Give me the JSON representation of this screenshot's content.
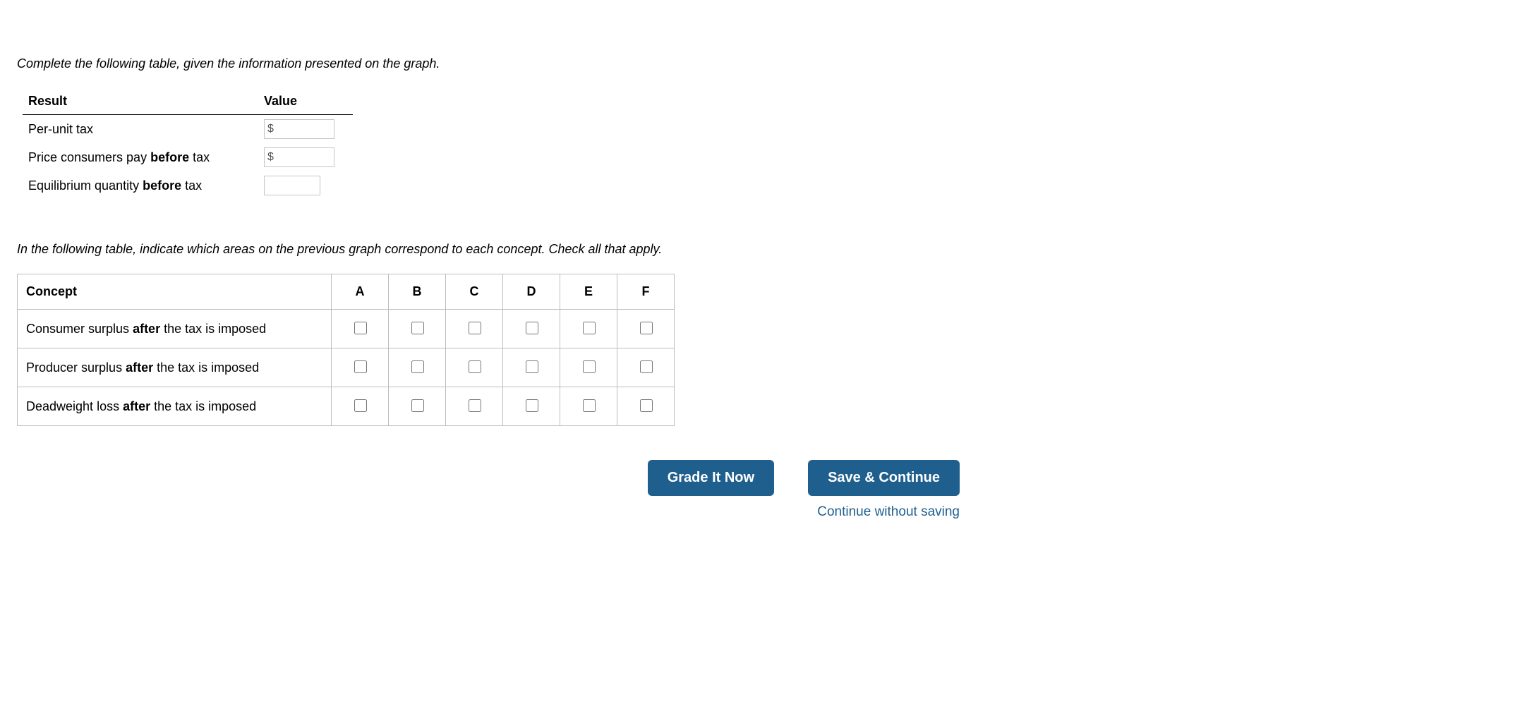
{
  "instruction1": "Complete the following table, given the information presented on the graph.",
  "table1": {
    "header_result": "Result",
    "header_value": "Value",
    "rows": [
      {
        "label_pre": "Per-unit tax",
        "label_bold": "",
        "label_post": "",
        "prefix": "$",
        "value": ""
      },
      {
        "label_pre": "Price consumers pay ",
        "label_bold": "before",
        "label_post": " tax",
        "prefix": "$",
        "value": ""
      },
      {
        "label_pre": "Equilibrium quantity ",
        "label_bold": "before",
        "label_post": " tax",
        "prefix": "",
        "value": ""
      }
    ]
  },
  "instruction2": "In the following table, indicate which areas on the previous graph correspond to each concept. Check all that apply.",
  "table2": {
    "header_concept": "Concept",
    "area_headers": [
      "A",
      "B",
      "C",
      "D",
      "E",
      "F"
    ],
    "rows": [
      {
        "label_pre": "Consumer surplus ",
        "label_bold": "after",
        "label_post": "  the tax is imposed"
      },
      {
        "label_pre": "Producer surplus ",
        "label_bold": "after",
        "label_post": "  the tax is imposed"
      },
      {
        "label_pre": "Deadweight loss ",
        "label_bold": "after",
        "label_post": " the tax is imposed"
      }
    ]
  },
  "actions": {
    "grade": "Grade It Now",
    "save": "Save & Continue",
    "skip": "Continue without saving"
  }
}
